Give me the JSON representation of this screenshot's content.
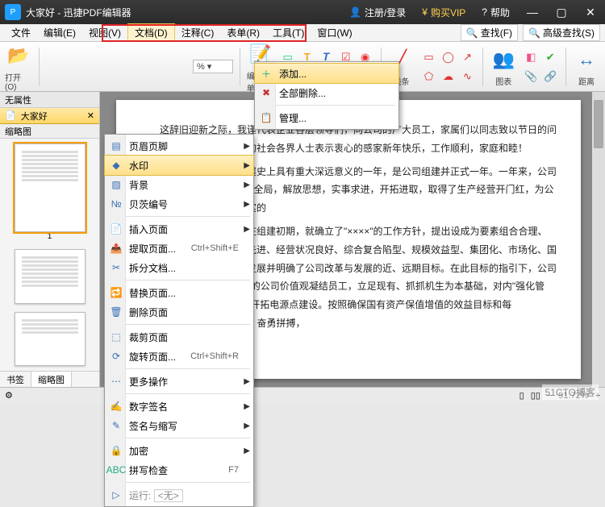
{
  "titlebar": {
    "title": "大家好 - 迅捷PDF编辑器",
    "register": "注册/登录",
    "vip": "购买VIP",
    "help": "帮助"
  },
  "menubar": {
    "items": [
      "文件",
      "编辑(E)",
      "视图(V)",
      "文档(D)",
      "注释(C)",
      "表单(R)",
      "工具(T)",
      "窗口(W)"
    ],
    "find": "查找(F)",
    "advfind": "高级查找(S)"
  },
  "toolbar": {
    "open": "打开(O)",
    "edit_form": "编辑表单",
    "lines": "线条",
    "chart": "图表",
    "distance": "距离"
  },
  "left": {
    "noattr": "无属性",
    "tab": "大家好",
    "thumbs_header": "缩略图",
    "page1": "1",
    "bookmarks": "书签",
    "thumbs_tab": "缩略图"
  },
  "doc_menu": {
    "items": [
      {
        "label": "页眉页脚",
        "sub": true
      },
      {
        "label": "水印",
        "sub": true,
        "hl": true
      },
      {
        "label": "背景",
        "sub": true
      },
      {
        "label": "贝茨编号",
        "sub": true
      },
      {
        "label": "插入页面",
        "sub": true
      },
      {
        "label": "提取页面...",
        "shortcut": "Ctrl+Shift+E"
      },
      {
        "label": "拆分文档..."
      },
      {
        "label": "替换页面..."
      },
      {
        "label": "删除页面"
      },
      {
        "label": "裁剪页面"
      },
      {
        "label": "旋转页面...",
        "shortcut": "Ctrl+Shift+R"
      },
      {
        "label": "更多操作",
        "sub": true
      },
      {
        "label": "数字签名",
        "sub": true
      },
      {
        "label": "签名与缩写",
        "sub": true
      },
      {
        "label": "加密",
        "sub": true
      },
      {
        "label": "拼写检查",
        "shortcut": "F7"
      }
    ],
    "run": "运行:",
    "run_val": "<无>"
  },
  "watermark_menu": {
    "add": "添加...",
    "remove": "全部删除...",
    "manage": "管理..."
  },
  "content": {
    "p1": "这辞旧迎新之际，我谨代表企业各层领导们，向公司的广大员工，家属们以同志致以节日的问候！向关心支持公司事业的社会各界人士表示衷心的感家新年快乐，工作顺利，家庭和睦！",
    "p2": "，是中国电力工业发展史上具有重大深远意义的一年，是公司组建并正式一年。一年来，公司以\"三个代表\"重要思想统领全局，解放思想，实事求进，开拓进取，取得了生产经营开门红，为公司持续健康发展奠定了坚实的",
    "p3": "公司第一要务。公司在组建初期，就确立了\"××××\"的工作方针，提出设成为要素组合合理、资源配置优化、管理机制先进、经营状况良好、综合复合陷型、规模效益型、集团化、市场化、国际化的现代化企业集团的发展并明确了公司改革与发展的近、远期目标。在此目标的指引下，公司上下共\"的理念，以\"××××\"的公司价值观凝结员工，立足现有、抓抓机生为本基础，对内\"强化管理，提高效益\"，对外积极开拓电源点建设。按照确保国有资产保值增值的效益目标和每年\"××××\"的电源建设目标，奋勇拼搏，"
  },
  "status": {
    "zoom": "91.72%",
    "blog": "51CTO博客"
  }
}
